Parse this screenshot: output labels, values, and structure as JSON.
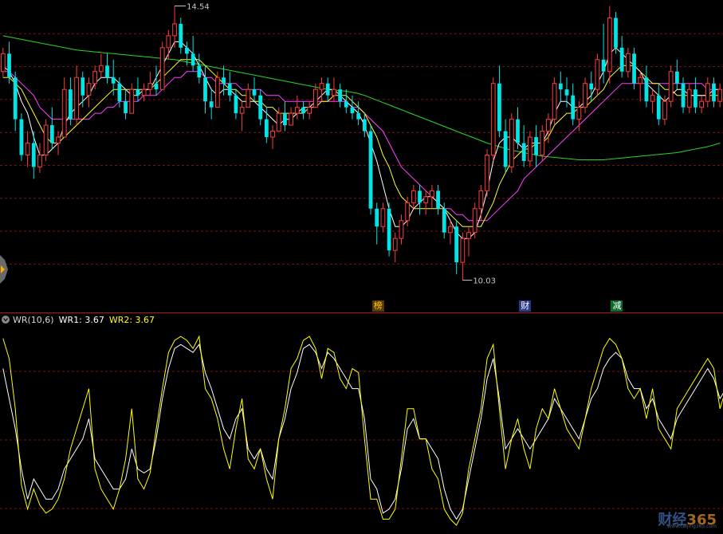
{
  "chart_data": {
    "type": "candlestick",
    "price_axis": {
      "min": 9.7,
      "max": 14.7
    },
    "dashed_grid": true,
    "annotations": {
      "high_label": "14.54",
      "low_label": "10.03"
    },
    "colors": {
      "up": "#ff3c3c",
      "down": "#00e5e5",
      "ma_white": "#ffffff",
      "ma_yellow": "#ffff30",
      "ma_magenta": "#ff40ff",
      "ma_green": "#28d828",
      "wr1": "#ffffff",
      "wr2": "#ffff00",
      "grid": "#7a1010",
      "divider": "#b01818"
    },
    "candles": [
      [
        13.5,
        13.9,
        13.4,
        13.8
      ],
      [
        13.8,
        14.0,
        13.3,
        13.4
      ],
      [
        13.4,
        13.5,
        12.5,
        12.7
      ],
      [
        12.7,
        12.8,
        12.0,
        12.1
      ],
      [
        12.1,
        12.5,
        11.9,
        12.3
      ],
      [
        12.3,
        12.5,
        11.7,
        11.9
      ],
      [
        11.9,
        12.3,
        11.8,
        12.1
      ],
      [
        12.1,
        12.7,
        12.0,
        12.6
      ],
      [
        12.6,
        12.9,
        12.2,
        12.3
      ],
      [
        12.3,
        12.5,
        12.1,
        12.4
      ],
      [
        12.4,
        13.4,
        12.4,
        13.2
      ],
      [
        13.2,
        13.4,
        12.6,
        12.7
      ],
      [
        12.7,
        13.6,
        12.6,
        13.4
      ],
      [
        13.4,
        13.5,
        12.9,
        13.1
      ],
      [
        13.1,
        13.4,
        12.9,
        13.3
      ],
      [
        13.3,
        13.6,
        13.2,
        13.5
      ],
      [
        13.5,
        13.8,
        13.4,
        13.6
      ],
      [
        13.6,
        13.8,
        13.3,
        13.4
      ],
      [
        13.4,
        13.7,
        13.1,
        13.3
      ],
      [
        13.3,
        13.4,
        12.9,
        13.0
      ],
      [
        13.0,
        13.2,
        12.7,
        12.8
      ],
      [
        12.8,
        13.3,
        12.8,
        13.2
      ],
      [
        13.2,
        13.4,
        13.0,
        13.1
      ],
      [
        13.1,
        13.3,
        13.0,
        13.2
      ],
      [
        13.2,
        13.5,
        13.1,
        13.3
      ],
      [
        13.3,
        13.6,
        13.1,
        13.2
      ],
      [
        13.2,
        14.0,
        13.2,
        13.9
      ],
      [
        13.9,
        14.2,
        13.7,
        14.1
      ],
      [
        14.1,
        14.6,
        13.9,
        14.3
      ],
      [
        14.3,
        14.4,
        13.8,
        13.9
      ],
      [
        13.9,
        14.0,
        13.6,
        13.8
      ],
      [
        13.8,
        14.1,
        13.5,
        13.6
      ],
      [
        13.6,
        13.8,
        13.3,
        13.4
      ],
      [
        13.4,
        13.6,
        12.8,
        13.0
      ],
      [
        13.0,
        13.2,
        12.7,
        12.9
      ],
      [
        12.9,
        13.5,
        12.9,
        13.4
      ],
      [
        13.4,
        13.6,
        13.1,
        13.3
      ],
      [
        13.3,
        13.5,
        13.0,
        13.1
      ],
      [
        13.1,
        13.2,
        12.7,
        12.8
      ],
      [
        12.8,
        13.0,
        12.5,
        12.9
      ],
      [
        12.9,
        13.3,
        12.9,
        13.2
      ],
      [
        13.2,
        13.4,
        13.0,
        13.1
      ],
      [
        13.1,
        13.2,
        12.6,
        12.7
      ],
      [
        12.7,
        12.9,
        12.3,
        12.4
      ],
      [
        12.4,
        12.6,
        12.2,
        12.5
      ],
      [
        12.5,
        12.9,
        12.5,
        12.8
      ],
      [
        12.8,
        13.0,
        12.5,
        12.6
      ],
      [
        12.6,
        12.9,
        12.6,
        12.8
      ],
      [
        12.8,
        13.1,
        12.7,
        12.9
      ],
      [
        12.9,
        13.0,
        12.7,
        12.8
      ],
      [
        12.8,
        13.0,
        12.7,
        12.9
      ],
      [
        12.9,
        13.3,
        12.9,
        13.2
      ],
      [
        13.2,
        13.4,
        13.0,
        13.3
      ],
      [
        13.3,
        13.4,
        13.0,
        13.1
      ],
      [
        13.1,
        13.4,
        13.0,
        13.2
      ],
      [
        13.2,
        13.3,
        12.9,
        13.0
      ],
      [
        13.0,
        13.2,
        12.8,
        12.9
      ],
      [
        12.9,
        13.1,
        12.7,
        12.8
      ],
      [
        12.8,
        13.0,
        12.6,
        12.7
      ],
      [
        12.7,
        12.8,
        12.4,
        12.5
      ],
      [
        12.5,
        12.6,
        11.1,
        11.2
      ],
      [
        11.2,
        11.3,
        10.6,
        10.9
      ],
      [
        10.9,
        11.3,
        10.8,
        11.2
      ],
      [
        11.2,
        11.3,
        10.4,
        10.5
      ],
      [
        10.5,
        10.8,
        10.3,
        10.7
      ],
      [
        10.7,
        11.1,
        10.6,
        11.0
      ],
      [
        11.0,
        11.4,
        10.9,
        11.3
      ],
      [
        11.3,
        11.6,
        11.2,
        11.5
      ],
      [
        11.5,
        11.6,
        11.1,
        11.3
      ],
      [
        11.3,
        11.5,
        11.1,
        11.4
      ],
      [
        11.4,
        11.6,
        11.2,
        11.5
      ],
      [
        11.5,
        11.6,
        11.1,
        11.2
      ],
      [
        11.2,
        11.3,
        10.7,
        10.8
      ],
      [
        10.8,
        11.0,
        10.6,
        10.9
      ],
      [
        10.9,
        11.0,
        10.1,
        10.3
      ],
      [
        10.3,
        10.8,
        10.0,
        10.7
      ],
      [
        10.7,
        10.9,
        10.4,
        10.8
      ],
      [
        10.8,
        11.3,
        10.7,
        11.2
      ],
      [
        11.2,
        11.6,
        11.0,
        11.5
      ],
      [
        11.5,
        12.2,
        11.4,
        12.1
      ],
      [
        12.1,
        13.4,
        12.0,
        13.3
      ],
      [
        13.3,
        13.6,
        12.4,
        12.5
      ],
      [
        12.5,
        12.7,
        11.8,
        11.9
      ],
      [
        11.9,
        12.8,
        11.8,
        12.7
      ],
      [
        12.7,
        12.9,
        12.2,
        12.3
      ],
      [
        12.3,
        12.6,
        11.9,
        12.0
      ],
      [
        12.0,
        12.5,
        11.9,
        12.4
      ],
      [
        12.4,
        12.6,
        11.9,
        12.1
      ],
      [
        12.1,
        12.6,
        12.0,
        12.5
      ],
      [
        12.5,
        12.8,
        12.3,
        12.7
      ],
      [
        12.7,
        13.4,
        12.6,
        13.3
      ],
      [
        13.3,
        13.5,
        13.0,
        13.2
      ],
      [
        13.2,
        13.4,
        12.9,
        13.1
      ],
      [
        13.1,
        13.3,
        12.6,
        12.7
      ],
      [
        12.7,
        13.0,
        12.5,
        12.9
      ],
      [
        12.9,
        13.4,
        12.8,
        13.3
      ],
      [
        13.3,
        13.5,
        13.0,
        13.2
      ],
      [
        13.2,
        13.8,
        13.1,
        13.7
      ],
      [
        13.7,
        14.3,
        13.3,
        13.5
      ],
      [
        13.5,
        14.6,
        13.3,
        14.4
      ],
      [
        14.4,
        14.5,
        13.8,
        13.9
      ],
      [
        13.9,
        14.1,
        13.4,
        13.5
      ],
      [
        13.5,
        13.9,
        13.4,
        13.8
      ],
      [
        13.8,
        13.9,
        13.2,
        13.3
      ],
      [
        13.3,
        13.5,
        13.0,
        13.4
      ],
      [
        13.4,
        13.6,
        12.9,
        13.0
      ],
      [
        13.0,
        13.2,
        12.8,
        13.1
      ],
      [
        13.1,
        13.3,
        12.6,
        12.7
      ],
      [
        12.7,
        13.1,
        12.6,
        13.0
      ],
      [
        13.0,
        13.6,
        12.9,
        13.5
      ],
      [
        13.5,
        13.7,
        13.2,
        13.3
      ],
      [
        13.3,
        13.4,
        12.8,
        12.9
      ],
      [
        12.9,
        13.3,
        12.8,
        13.2
      ],
      [
        13.2,
        13.4,
        12.8,
        12.9
      ],
      [
        12.9,
        13.1,
        12.8,
        13.0
      ],
      [
        13.0,
        13.4,
        12.9,
        13.3
      ],
      [
        13.3,
        13.4,
        12.9,
        13.0
      ],
      [
        13.0,
        13.3,
        12.9,
        13.2
      ]
    ],
    "ma": {
      "white": [
        13.6,
        13.5,
        13.3,
        13.0,
        12.8,
        12.4,
        12.1,
        12.1,
        12.2,
        12.3,
        12.6,
        12.8,
        12.9,
        13.0,
        13.1,
        13.3,
        13.4,
        13.4,
        13.4,
        13.3,
        13.2,
        13.1,
        13.1,
        13.2,
        13.2,
        13.4,
        13.6,
        13.8,
        14.0,
        14.0,
        13.9,
        13.8,
        13.6,
        13.4,
        13.2,
        13.1,
        13.2,
        13.2,
        13.1,
        13.0,
        13.0,
        13.0,
        12.9,
        12.8,
        12.7,
        12.6,
        12.7,
        12.7,
        12.8,
        12.9,
        12.9,
        13.0,
        13.1,
        13.2,
        13.2,
        13.1,
        13.0,
        12.9,
        12.8,
        12.6,
        12.3,
        12.0,
        11.6,
        11.2,
        10.9,
        10.9,
        11.0,
        11.2,
        11.3,
        11.4,
        11.4,
        11.3,
        11.2,
        11.0,
        10.8,
        10.7,
        10.7,
        10.8,
        11.1,
        11.5,
        12.0,
        12.3,
        12.4,
        12.4,
        12.3,
        12.2,
        12.3,
        12.3,
        12.3,
        12.5,
        12.8,
        13.0,
        13.0,
        12.9,
        12.9,
        13.0,
        13.1,
        13.3,
        13.5,
        13.8,
        13.9,
        13.8,
        13.7,
        13.6,
        13.5,
        13.3,
        13.2,
        13.1,
        13.0,
        13.1,
        13.2,
        13.2,
        13.1,
        13.1,
        13.1,
        13.1,
        13.2,
        13.2
      ],
      "yellow": [
        13.4,
        13.4,
        13.3,
        13.2,
        13.0,
        12.8,
        12.6,
        12.4,
        12.3,
        12.3,
        12.4,
        12.5,
        12.6,
        12.7,
        12.8,
        12.9,
        13.0,
        13.1,
        13.2,
        13.2,
        13.2,
        13.2,
        13.2,
        13.2,
        13.2,
        13.3,
        13.4,
        13.5,
        13.6,
        13.7,
        13.7,
        13.7,
        13.7,
        13.6,
        13.5,
        13.4,
        13.3,
        13.2,
        13.2,
        13.1,
        13.1,
        13.0,
        13.0,
        12.9,
        12.9,
        12.8,
        12.8,
        12.8,
        12.8,
        12.8,
        12.9,
        12.9,
        13.0,
        13.0,
        13.1,
        13.1,
        13.1,
        13.0,
        12.9,
        12.8,
        12.6,
        12.4,
        12.1,
        11.9,
        11.6,
        11.4,
        11.3,
        11.2,
        11.2,
        11.2,
        11.2,
        11.2,
        11.2,
        11.1,
        11.0,
        10.9,
        10.9,
        10.9,
        10.9,
        11.1,
        11.3,
        11.6,
        11.8,
        12.0,
        12.1,
        12.2,
        12.2,
        12.3,
        12.3,
        12.4,
        12.6,
        12.7,
        12.8,
        12.8,
        12.9,
        12.9,
        13.0,
        13.1,
        13.2,
        13.4,
        13.5,
        13.6,
        13.6,
        13.6,
        13.5,
        13.4,
        13.3,
        13.3,
        13.2,
        13.2,
        13.1,
        13.1,
        13.1,
        13.1,
        13.1,
        13.1,
        13.1,
        13.1
      ],
      "magenta": [
        13.5,
        13.5,
        13.4,
        13.3,
        13.2,
        13.1,
        12.9,
        12.8,
        12.7,
        12.7,
        12.7,
        12.7,
        12.7,
        12.7,
        12.7,
        12.8,
        12.8,
        12.9,
        12.9,
        13.0,
        13.0,
        13.0,
        13.0,
        13.1,
        13.1,
        13.1,
        13.2,
        13.3,
        13.4,
        13.4,
        13.5,
        13.5,
        13.5,
        13.4,
        13.4,
        13.3,
        13.3,
        13.3,
        13.3,
        13.2,
        13.2,
        13.2,
        13.2,
        13.1,
        13.1,
        13.1,
        13.0,
        13.0,
        13.0,
        13.0,
        13.0,
        13.0,
        13.0,
        13.0,
        13.0,
        13.0,
        13.0,
        12.9,
        12.9,
        12.8,
        12.7,
        12.6,
        12.5,
        12.3,
        12.1,
        11.9,
        11.8,
        11.7,
        11.6,
        11.5,
        11.4,
        11.3,
        11.2,
        11.2,
        11.1,
        11.1,
        11.0,
        11.0,
        11.0,
        11.0,
        11.1,
        11.2,
        11.3,
        11.4,
        11.5,
        11.7,
        11.8,
        11.9,
        12.0,
        12.1,
        12.2,
        12.3,
        12.4,
        12.5,
        12.6,
        12.7,
        12.8,
        12.9,
        13.0,
        13.1,
        13.2,
        13.3,
        13.3,
        13.3,
        13.3,
        13.3,
        13.3,
        13.3,
        13.3,
        13.3,
        13.3,
        13.3,
        13.3,
        13.3,
        13.3,
        13.2,
        13.2,
        13.2
      ],
      "green": [
        14.1,
        14.08,
        14.06,
        14.04,
        14.02,
        14.0,
        13.98,
        13.96,
        13.94,
        13.92,
        13.9,
        13.88,
        13.86,
        13.85,
        13.84,
        13.83,
        13.82,
        13.81,
        13.8,
        13.79,
        13.78,
        13.77,
        13.76,
        13.75,
        13.74,
        13.73,
        13.72,
        13.71,
        13.7,
        13.68,
        13.66,
        13.64,
        13.62,
        13.6,
        13.58,
        13.56,
        13.54,
        13.52,
        13.5,
        13.48,
        13.46,
        13.44,
        13.42,
        13.4,
        13.38,
        13.36,
        13.34,
        13.32,
        13.3,
        13.28,
        13.26,
        13.24,
        13.22,
        13.2,
        13.19,
        13.18,
        13.17,
        13.15,
        13.13,
        13.1,
        13.06,
        13.02,
        12.98,
        12.94,
        12.9,
        12.86,
        12.82,
        12.78,
        12.74,
        12.7,
        12.66,
        12.62,
        12.58,
        12.54,
        12.5,
        12.46,
        12.42,
        12.38,
        12.34,
        12.3,
        12.27,
        12.24,
        12.21,
        12.18,
        12.16,
        12.14,
        12.12,
        12.1,
        12.08,
        12.07,
        12.06,
        12.05,
        12.04,
        12.03,
        12.02,
        12.02,
        12.02,
        12.02,
        12.02,
        12.03,
        12.04,
        12.05,
        12.06,
        12.07,
        12.08,
        12.09,
        12.1,
        12.11,
        12.12,
        12.13,
        12.14,
        12.16,
        12.18,
        12.2,
        12.22,
        12.24,
        12.27,
        12.3
      ]
    },
    "wr_indicator": {
      "label": "WR(10,6)",
      "wr1_label": "WR1: 3.67",
      "wr2_label": "WR2: 3.67",
      "range": [
        0,
        100
      ],
      "wr1": [
        20,
        35,
        50,
        70,
        85,
        75,
        80,
        85,
        85,
        80,
        70,
        65,
        60,
        55,
        45,
        65,
        70,
        75,
        80,
        80,
        75,
        60,
        70,
        72,
        70,
        55,
        35,
        20,
        10,
        8,
        10,
        12,
        8,
        22,
        30,
        40,
        50,
        55,
        45,
        40,
        60,
        65,
        60,
        70,
        75,
        55,
        45,
        30,
        22,
        10,
        8,
        12,
        20,
        12,
        15,
        20,
        25,
        30,
        30,
        45,
        75,
        80,
        92,
        90,
        85,
        70,
        50,
        45,
        55,
        55,
        60,
        65,
        80,
        90,
        95,
        90,
        75,
        60,
        45,
        25,
        15,
        35,
        60,
        55,
        50,
        55,
        60,
        55,
        50,
        45,
        35,
        40,
        45,
        50,
        55,
        45,
        35,
        30,
        20,
        15,
        12,
        15,
        25,
        30,
        30,
        40,
        35,
        45,
        50,
        55,
        45,
        40,
        35,
        30,
        25,
        20,
        25,
        35,
        30,
        25
      ],
      "wr2": [
        5,
        15,
        40,
        78,
        90,
        80,
        88,
        92,
        90,
        85,
        75,
        60,
        50,
        40,
        30,
        70,
        80,
        85,
        90,
        80,
        65,
        40,
        75,
        80,
        72,
        50,
        30,
        12,
        6,
        4,
        6,
        10,
        4,
        30,
        35,
        45,
        60,
        70,
        50,
        35,
        65,
        70,
        60,
        75,
        85,
        55,
        40,
        20,
        15,
        6,
        4,
        10,
        25,
        10,
        12,
        25,
        30,
        20,
        22,
        55,
        85,
        85,
        95,
        95,
        90,
        65,
        40,
        40,
        55,
        55,
        70,
        75,
        90,
        95,
        98,
        92,
        70,
        55,
        40,
        15,
        8,
        40,
        70,
        55,
        45,
        60,
        70,
        50,
        40,
        45,
        30,
        40,
        50,
        55,
        60,
        45,
        30,
        20,
        10,
        5,
        8,
        15,
        30,
        35,
        30,
        45,
        30,
        50,
        55,
        60,
        40,
        35,
        30,
        25,
        20,
        15,
        20,
        40,
        30,
        20
      ]
    },
    "event_tags": [
      {
        "text": "榜",
        "index": 61,
        "color": "#ffcc00",
        "bg": "#5a3a00"
      },
      {
        "text": "财",
        "index": 85,
        "color": "#ffffff",
        "bg": "#2a3a8a"
      },
      {
        "text": "减",
        "index": 100,
        "color": "#ffffff",
        "bg": "#0a6a2a"
      }
    ]
  },
  "watermark": {
    "main": "财经",
    "num": "365",
    "sub": "www.caijing365.com"
  }
}
